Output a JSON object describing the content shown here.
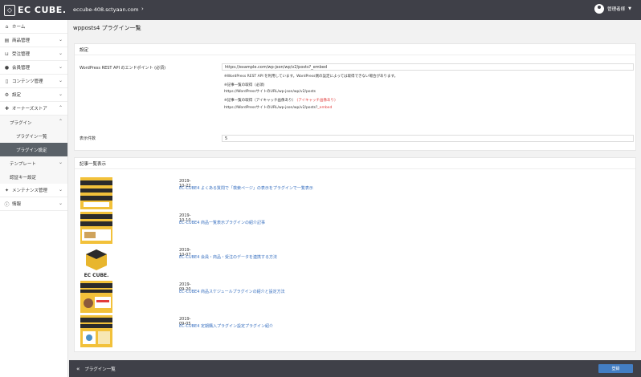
{
  "topbar": {
    "logo_text": "EC CUBE.",
    "host": "eccube-408.sctyaan.com",
    "user_name": "管理者様"
  },
  "sidebar": {
    "items": [
      {
        "label": "ホーム",
        "icon": "home-icon"
      },
      {
        "label": "商品管理",
        "icon": "tag-icon"
      },
      {
        "label": "受注管理",
        "icon": "cart-icon"
      },
      {
        "label": "会員管理",
        "icon": "user-icon"
      },
      {
        "label": "コンテンツ管理",
        "icon": "file-icon"
      },
      {
        "label": "設定",
        "icon": "gear-icon"
      },
      {
        "label": "オーナーズストア",
        "icon": "store-icon"
      }
    ],
    "store_sub": {
      "plugin_label": "プラグイン",
      "plugin_children": [
        {
          "label": "プラグイン一覧"
        },
        {
          "label": "プラグイン設定"
        }
      ],
      "template_label": "テンプレート",
      "auth_label": "認証キー設定"
    },
    "bottom_items": [
      {
        "label": "メンテナンス管理",
        "icon": "wrench-icon"
      },
      {
        "label": "情報",
        "icon": "info-icon"
      }
    ]
  },
  "main": {
    "page_title": "wpposts4 プラグイン一覧",
    "settings_card": {
      "title": "設定",
      "url_label": "WordPress REST API のエンドポイント (必須)",
      "url_value": "https://example.com/wp-json/wp/v2/posts?_embed",
      "help_line1": "※WordPress REST API を利用しています。WordPress側の設定によっては取得できない場合があります。",
      "help_line2": "※記事一覧の取得（必須）",
      "help_line3": "https://WordPressサイトのURL/wp-json/wp/v2/posts",
      "help_line4": "※記事一覧の取得（アイキャッチ画像あり）",
      "help_line4_red": "(アイキャッチ画像あり)",
      "help_line5_prefix": "https://WordPressサイトのURL/wp-json/wp/v2/posts?",
      "help_line5_red": "_embed",
      "count_label": "表示件数",
      "count_value": "5"
    },
    "articles_card": {
      "title": "記事一覧表示",
      "articles": [
        {
          "date": "2019-10-22",
          "title": "EC-CUBE4 よくある質問で「検索ページ」の表示をプラグインで一覧表示"
        },
        {
          "date": "2019-10-10",
          "title": "EC-CUBE4 商品一覧表示プラグインの紹介記事"
        },
        {
          "date": "2019-10-07",
          "title": "EC-CUBE4 会員・商品・受注のデータを連携する方法"
        },
        {
          "date": "2019-09-20",
          "title": "EC-CUBE4 商品スケジュールプラグインの紹介と設定方法"
        },
        {
          "date": "2019-09-05",
          "title": "EC-CUBE4 定期購入プラグイン設定プラグイン紹介"
        }
      ]
    }
  },
  "bottombar": {
    "back_label": "プラグイン一覧",
    "save_label": "登録"
  },
  "colors": {
    "topbar": "#3f4048",
    "accent": "#437ec4",
    "link": "#3870c0",
    "required_red": "#e03a3a",
    "active_nav": "#5a6168"
  }
}
